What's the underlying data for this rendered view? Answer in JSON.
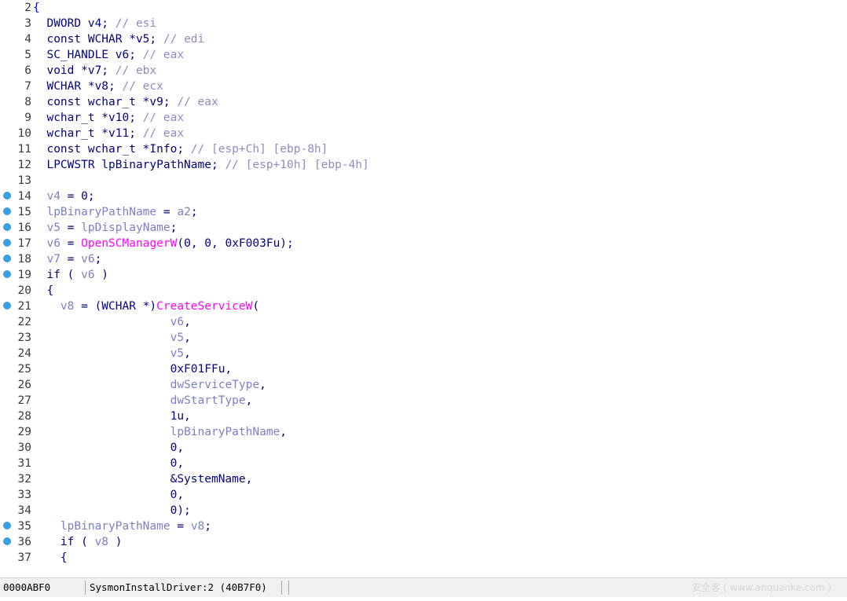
{
  "colors": {
    "code": "#000080",
    "variable": "#7b7fc8",
    "function": "#ff00ff",
    "comment": "#8c8cc4",
    "brace": "#0000ff",
    "breakpoint": "#3aa0e0",
    "background": "#ffffff",
    "status_bg": "#f0f0f0"
  },
  "editor": {
    "lines": [
      {
        "num": "2",
        "bp": false,
        "tokens": [
          {
            "t": "{",
            "c": "b"
          }
        ]
      },
      {
        "num": "3",
        "bp": false,
        "tokens": [
          {
            "t": "  DWORD v4; ",
            "c": "c"
          },
          {
            "t": "// esi",
            "c": "m"
          }
        ]
      },
      {
        "num": "4",
        "bp": false,
        "tokens": [
          {
            "t": "  const WCHAR *v5; ",
            "c": "c"
          },
          {
            "t": "// edi",
            "c": "m"
          }
        ]
      },
      {
        "num": "5",
        "bp": false,
        "tokens": [
          {
            "t": "  SC_HANDLE v6; ",
            "c": "c"
          },
          {
            "t": "// eax",
            "c": "m"
          }
        ]
      },
      {
        "num": "6",
        "bp": false,
        "tokens": [
          {
            "t": "  void *v7; ",
            "c": "c"
          },
          {
            "t": "// ebx",
            "c": "m"
          }
        ]
      },
      {
        "num": "7",
        "bp": false,
        "tokens": [
          {
            "t": "  WCHAR *v8; ",
            "c": "c"
          },
          {
            "t": "// ecx",
            "c": "m"
          }
        ]
      },
      {
        "num": "8",
        "bp": false,
        "tokens": [
          {
            "t": "  const wchar_t *v9; ",
            "c": "c"
          },
          {
            "t": "// eax",
            "c": "m"
          }
        ]
      },
      {
        "num": "9",
        "bp": false,
        "tokens": [
          {
            "t": "  wchar_t *v10; ",
            "c": "c"
          },
          {
            "t": "// eax",
            "c": "m"
          }
        ]
      },
      {
        "num": "10",
        "bp": false,
        "tokens": [
          {
            "t": "  wchar_t *v11; ",
            "c": "c"
          },
          {
            "t": "// eax",
            "c": "m"
          }
        ]
      },
      {
        "num": "11",
        "bp": false,
        "tokens": [
          {
            "t": "  const wchar_t *Info; ",
            "c": "c"
          },
          {
            "t": "// [esp+Ch] [ebp-8h]",
            "c": "m"
          }
        ]
      },
      {
        "num": "12",
        "bp": false,
        "tokens": [
          {
            "t": "  LPCWSTR lpBinaryPathName; ",
            "c": "c"
          },
          {
            "t": "// [esp+10h] [ebp-4h]",
            "c": "m"
          }
        ]
      },
      {
        "num": "13",
        "bp": false,
        "tokens": []
      },
      {
        "num": "14",
        "bp": true,
        "tokens": [
          {
            "t": "  ",
            "c": "c"
          },
          {
            "t": "v4",
            "c": "v"
          },
          {
            "t": " = 0;",
            "c": "c"
          }
        ]
      },
      {
        "num": "15",
        "bp": true,
        "tokens": [
          {
            "t": "  ",
            "c": "c"
          },
          {
            "t": "lpBinaryPathName",
            "c": "v"
          },
          {
            "t": " = ",
            "c": "c"
          },
          {
            "t": "a2",
            "c": "v"
          },
          {
            "t": ";",
            "c": "c"
          }
        ]
      },
      {
        "num": "16",
        "bp": true,
        "tokens": [
          {
            "t": "  ",
            "c": "c"
          },
          {
            "t": "v5",
            "c": "v"
          },
          {
            "t": " = ",
            "c": "c"
          },
          {
            "t": "lpDisplayName",
            "c": "v"
          },
          {
            "t": ";",
            "c": "c"
          }
        ]
      },
      {
        "num": "17",
        "bp": true,
        "tokens": [
          {
            "t": "  ",
            "c": "c"
          },
          {
            "t": "v6",
            "c": "v"
          },
          {
            "t": " = ",
            "c": "c"
          },
          {
            "t": "OpenSCManagerW",
            "c": "f"
          },
          {
            "t": "(0, 0, 0xF003Fu);",
            "c": "c"
          }
        ]
      },
      {
        "num": "18",
        "bp": true,
        "tokens": [
          {
            "t": "  ",
            "c": "c"
          },
          {
            "t": "v7",
            "c": "v"
          },
          {
            "t": " = ",
            "c": "c"
          },
          {
            "t": "v6",
            "c": "v"
          },
          {
            "t": ";",
            "c": "c"
          }
        ]
      },
      {
        "num": "19",
        "bp": true,
        "tokens": [
          {
            "t": "  if ( ",
            "c": "c"
          },
          {
            "t": "v6",
            "c": "v"
          },
          {
            "t": " )",
            "c": "c"
          }
        ]
      },
      {
        "num": "20",
        "bp": false,
        "tokens": [
          {
            "t": "  {",
            "c": "c"
          }
        ]
      },
      {
        "num": "21",
        "bp": true,
        "tokens": [
          {
            "t": "    ",
            "c": "c"
          },
          {
            "t": "v8",
            "c": "v"
          },
          {
            "t": " = (WCHAR *)",
            "c": "c"
          },
          {
            "t": "CreateServiceW",
            "c": "f"
          },
          {
            "t": "(",
            "c": "c"
          }
        ]
      },
      {
        "num": "22",
        "bp": false,
        "tokens": [
          {
            "t": "                    ",
            "c": "c"
          },
          {
            "t": "v6",
            "c": "v"
          },
          {
            "t": ",",
            "c": "c"
          }
        ]
      },
      {
        "num": "23",
        "bp": false,
        "tokens": [
          {
            "t": "                    ",
            "c": "c"
          },
          {
            "t": "v5",
            "c": "v"
          },
          {
            "t": ",",
            "c": "c"
          }
        ]
      },
      {
        "num": "24",
        "bp": false,
        "tokens": [
          {
            "t": "                    ",
            "c": "c"
          },
          {
            "t": "v5",
            "c": "v"
          },
          {
            "t": ",",
            "c": "c"
          }
        ]
      },
      {
        "num": "25",
        "bp": false,
        "tokens": [
          {
            "t": "                    0xF01FFu,",
            "c": "c"
          }
        ]
      },
      {
        "num": "26",
        "bp": false,
        "tokens": [
          {
            "t": "                    ",
            "c": "c"
          },
          {
            "t": "dwServiceType",
            "c": "v"
          },
          {
            "t": ",",
            "c": "c"
          }
        ]
      },
      {
        "num": "27",
        "bp": false,
        "tokens": [
          {
            "t": "                    ",
            "c": "c"
          },
          {
            "t": "dwStartType",
            "c": "v"
          },
          {
            "t": ",",
            "c": "c"
          }
        ]
      },
      {
        "num": "28",
        "bp": false,
        "tokens": [
          {
            "t": "                    1u,",
            "c": "c"
          }
        ]
      },
      {
        "num": "29",
        "bp": false,
        "tokens": [
          {
            "t": "                    ",
            "c": "c"
          },
          {
            "t": "lpBinaryPathName",
            "c": "v"
          },
          {
            "t": ",",
            "c": "c"
          }
        ]
      },
      {
        "num": "30",
        "bp": false,
        "tokens": [
          {
            "t": "                    0,",
            "c": "c"
          }
        ]
      },
      {
        "num": "31",
        "bp": false,
        "tokens": [
          {
            "t": "                    0,",
            "c": "c"
          }
        ]
      },
      {
        "num": "32",
        "bp": false,
        "tokens": [
          {
            "t": "                    &SystemName,",
            "c": "c"
          }
        ]
      },
      {
        "num": "33",
        "bp": false,
        "tokens": [
          {
            "t": "                    0,",
            "c": "c"
          }
        ]
      },
      {
        "num": "34",
        "bp": false,
        "tokens": [
          {
            "t": "                    0);",
            "c": "c"
          }
        ]
      },
      {
        "num": "35",
        "bp": true,
        "tokens": [
          {
            "t": "    ",
            "c": "c"
          },
          {
            "t": "lpBinaryPathName",
            "c": "v"
          },
          {
            "t": " = ",
            "c": "c"
          },
          {
            "t": "v8",
            "c": "v"
          },
          {
            "t": ";",
            "c": "c"
          }
        ]
      },
      {
        "num": "36",
        "bp": true,
        "tokens": [
          {
            "t": "    if ( ",
            "c": "c"
          },
          {
            "t": "v8",
            "c": "v"
          },
          {
            "t": " )",
            "c": "c"
          }
        ]
      },
      {
        "num": "37",
        "bp": false,
        "tokens": [
          {
            "t": "    {",
            "c": "c"
          }
        ]
      }
    ]
  },
  "status": {
    "address": "0000ABF0",
    "location": "SysmonInstallDriver:2 (40B7F0)",
    "watermark": "安全客 ( www.anquanke.com )"
  }
}
